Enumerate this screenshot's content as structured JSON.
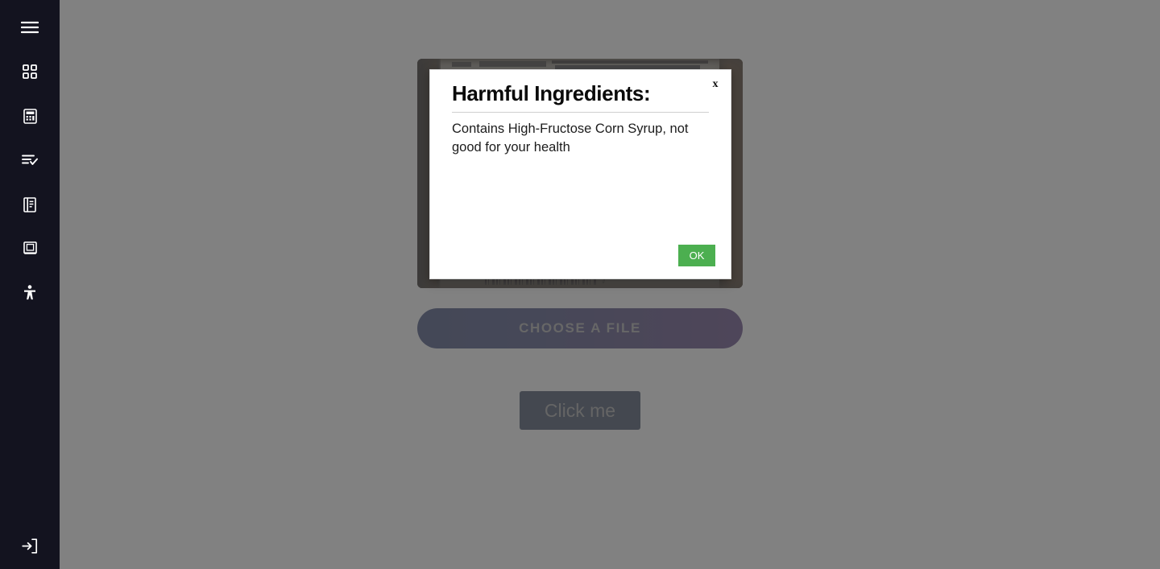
{
  "colors": {
    "sidebar_bg": "#13131f",
    "page_overlay": "#666666",
    "ok_button": "#4caf50",
    "choose_file_gradient_start": "#263469",
    "choose_file_gradient_end": "#4b2d72",
    "click_me_bg": "#26344f",
    "modal_bg": "#ffffff"
  },
  "sidebar": {
    "items": [
      {
        "icon": "hamburger-menu-icon",
        "label": "Menu"
      },
      {
        "icon": "grid-dashboard-icon",
        "label": "Dashboard"
      },
      {
        "icon": "calculator-icon",
        "label": "Calculator"
      },
      {
        "icon": "list-check-icon",
        "label": "Tasks"
      },
      {
        "icon": "book-open-icon",
        "label": "Journal"
      },
      {
        "icon": "book-closed-icon",
        "label": "Library"
      },
      {
        "icon": "accessibility-icon",
        "label": "Accessibility"
      }
    ],
    "footer": {
      "icon": "logout-icon",
      "label": "Log out"
    }
  },
  "main": {
    "preview": {
      "name": "uploaded-nutrition-label-photo",
      "alt": "Photograph of a product nutrition facts label with a barcode"
    },
    "choose_file_label": "CHOOSE A FILE",
    "click_me_label": "Click me"
  },
  "modal": {
    "title": "Harmful Ingredients:",
    "message": "Contains High-Fructose Corn Syrup, not good for your health",
    "close_label": "x",
    "ok_label": "OK"
  }
}
